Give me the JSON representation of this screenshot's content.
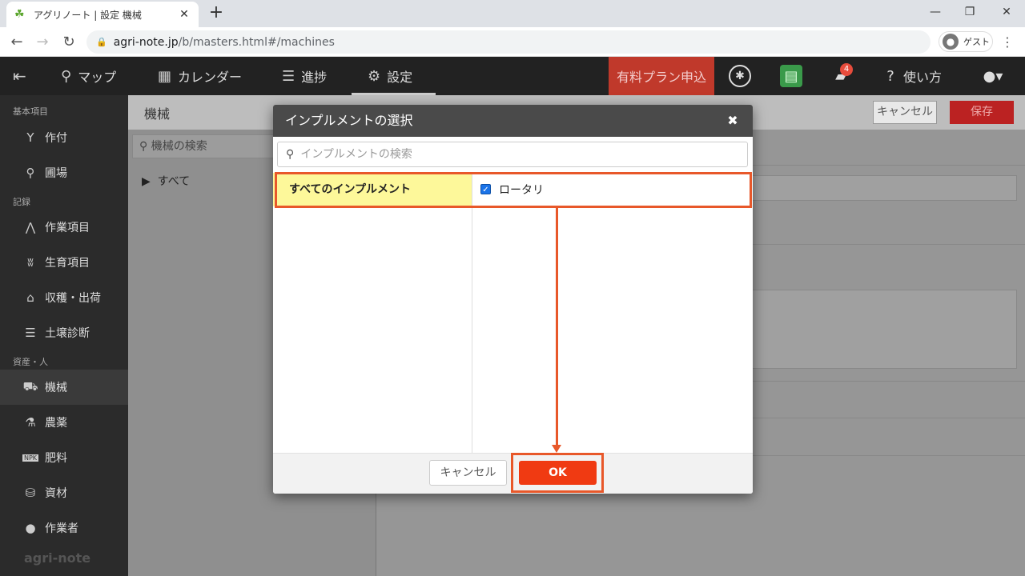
{
  "browser": {
    "tab_title": "アグリノート | 設定 機械",
    "tab_close": "✕",
    "new_tab": "+",
    "url_host": "agri-note.jp",
    "url_path": "/b/masters.html#/machines",
    "profile_label": "ゲスト",
    "minimize": "—",
    "restore": "❐",
    "close": "✕"
  },
  "header": {
    "nav": [
      {
        "icon": "map-pin-icon",
        "label": "マップ"
      },
      {
        "icon": "calendar-icon",
        "label": "カレンダー"
      },
      {
        "icon": "checklist-icon",
        "label": "進捗"
      },
      {
        "icon": "gear-icon",
        "label": "設定"
      }
    ],
    "paid_plan": "有料プラン申込",
    "notification_count": "4",
    "help_label": "使い方"
  },
  "sidebar": {
    "sections": [
      {
        "title": "基本項目",
        "items": [
          {
            "icon": "sprout-icon",
            "label": "作付"
          },
          {
            "icon": "location-icon",
            "label": "圃場"
          }
        ]
      },
      {
        "title": "記録",
        "items": [
          {
            "icon": "work-icon",
            "label": "作業項目"
          },
          {
            "icon": "growth-icon",
            "label": "生育項目"
          },
          {
            "icon": "basket-icon",
            "label": "収穫・出荷"
          },
          {
            "icon": "sliders-icon",
            "label": "土壌診断"
          }
        ]
      },
      {
        "title": "資産・人",
        "items": [
          {
            "icon": "tractor-icon",
            "label": "機械"
          },
          {
            "icon": "flask-icon",
            "label": "農薬"
          },
          {
            "icon": "npk-icon",
            "label": "肥料"
          },
          {
            "icon": "material-icon",
            "label": "資材"
          },
          {
            "icon": "person-icon",
            "label": "作業者"
          }
        ]
      }
    ],
    "active_item": "機械",
    "brand": "agri-note"
  },
  "main": {
    "title": "機械",
    "cancel_label": "キャンセル",
    "save_label": "保存",
    "search_placeholder": "機械の検索",
    "tree_root": "すべて"
  },
  "modal": {
    "title": "インプルメントの選択",
    "close": "✖",
    "search_placeholder": "インプルメントの検索",
    "category": "すべてのインプルメント",
    "implements": [
      {
        "label": "ロータリ",
        "checked": true
      }
    ],
    "cancel_label": "キャンセル",
    "ok_label": "OK"
  },
  "colors": {
    "highlight": "#e8582a",
    "ok_button": "#f03a12",
    "category_bg": "#fdf89a"
  }
}
